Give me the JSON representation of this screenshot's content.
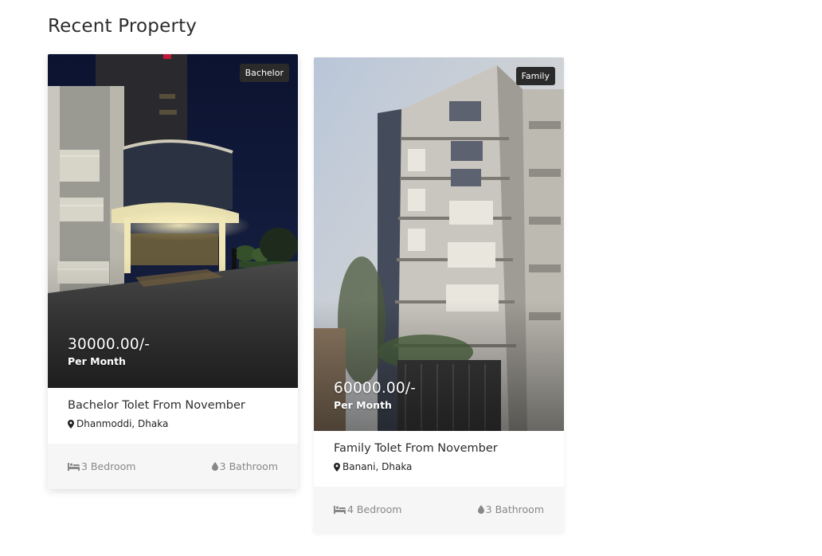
{
  "section": {
    "title": "Recent Property"
  },
  "properties": [
    {
      "tag": "Bachelor",
      "price": "30000.00/-",
      "price_unit": "Per Month",
      "title": "Bachelor Tolet From November",
      "location": "Dhanmoddi, Dhaka",
      "bedrooms": "3 Bedroom",
      "bathrooms": "3 Bathroom",
      "icons": {
        "location": "map-marker-icon",
        "bed": "bed-icon",
        "bath": "water-drop-icon"
      }
    },
    {
      "tag": "Family",
      "price": "60000.00/-",
      "price_unit": "Per Month",
      "title": "Family Tolet From November",
      "location": "Banani, Dhaka",
      "bedrooms": "4 Bedroom",
      "bathrooms": "3 Bathroom",
      "icons": {
        "location": "map-marker-icon",
        "bed": "bed-icon",
        "bath": "water-drop-icon"
      }
    }
  ],
  "colors": {
    "tag_bg": "#2a2a2a",
    "footer_bg": "#f6f6f6",
    "muted_text": "#888888"
  }
}
